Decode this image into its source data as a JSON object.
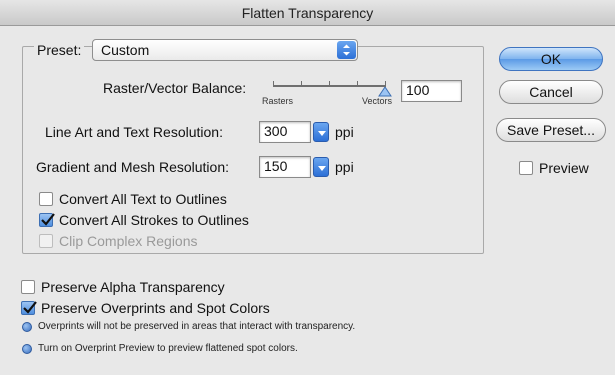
{
  "window": {
    "title": "Flatten Transparency"
  },
  "preset": {
    "label": "Preset:",
    "value": "Custom"
  },
  "raster_vector": {
    "label": "Raster/Vector Balance:",
    "left_label": "Rasters",
    "right_label": "Vectors",
    "value": "100",
    "slider_level_percent": 100
  },
  "line_art": {
    "label": "Line Art and Text Resolution:",
    "value": "300",
    "unit": "ppi"
  },
  "gradient_mesh": {
    "label": "Gradient and Mesh Resolution:",
    "value": "150",
    "unit": "ppi"
  },
  "options": [
    {
      "label": "Convert All Text to Outlines",
      "checked": false,
      "enabled": true
    },
    {
      "label": "Convert All Strokes to Outlines",
      "checked": true,
      "enabled": true
    },
    {
      "label": "Clip Complex Regions",
      "checked": false,
      "enabled": false
    }
  ],
  "bottom_options": [
    {
      "label": "Preserve Alpha Transparency",
      "checked": false
    },
    {
      "label": "Preserve Overprints and Spot Colors",
      "checked": true
    }
  ],
  "notes": [
    {
      "icon": "info-icon",
      "text": "Overprints will not be preserved in areas that interact with transparency."
    },
    {
      "icon": "info-icon",
      "text": "Turn on Overprint Preview to preview flattened spot colors."
    }
  ],
  "buttons": {
    "ok": "OK",
    "cancel": "Cancel",
    "save_preset": "Save Preset..."
  },
  "preview": {
    "label": "Preview",
    "checked": false
  }
}
